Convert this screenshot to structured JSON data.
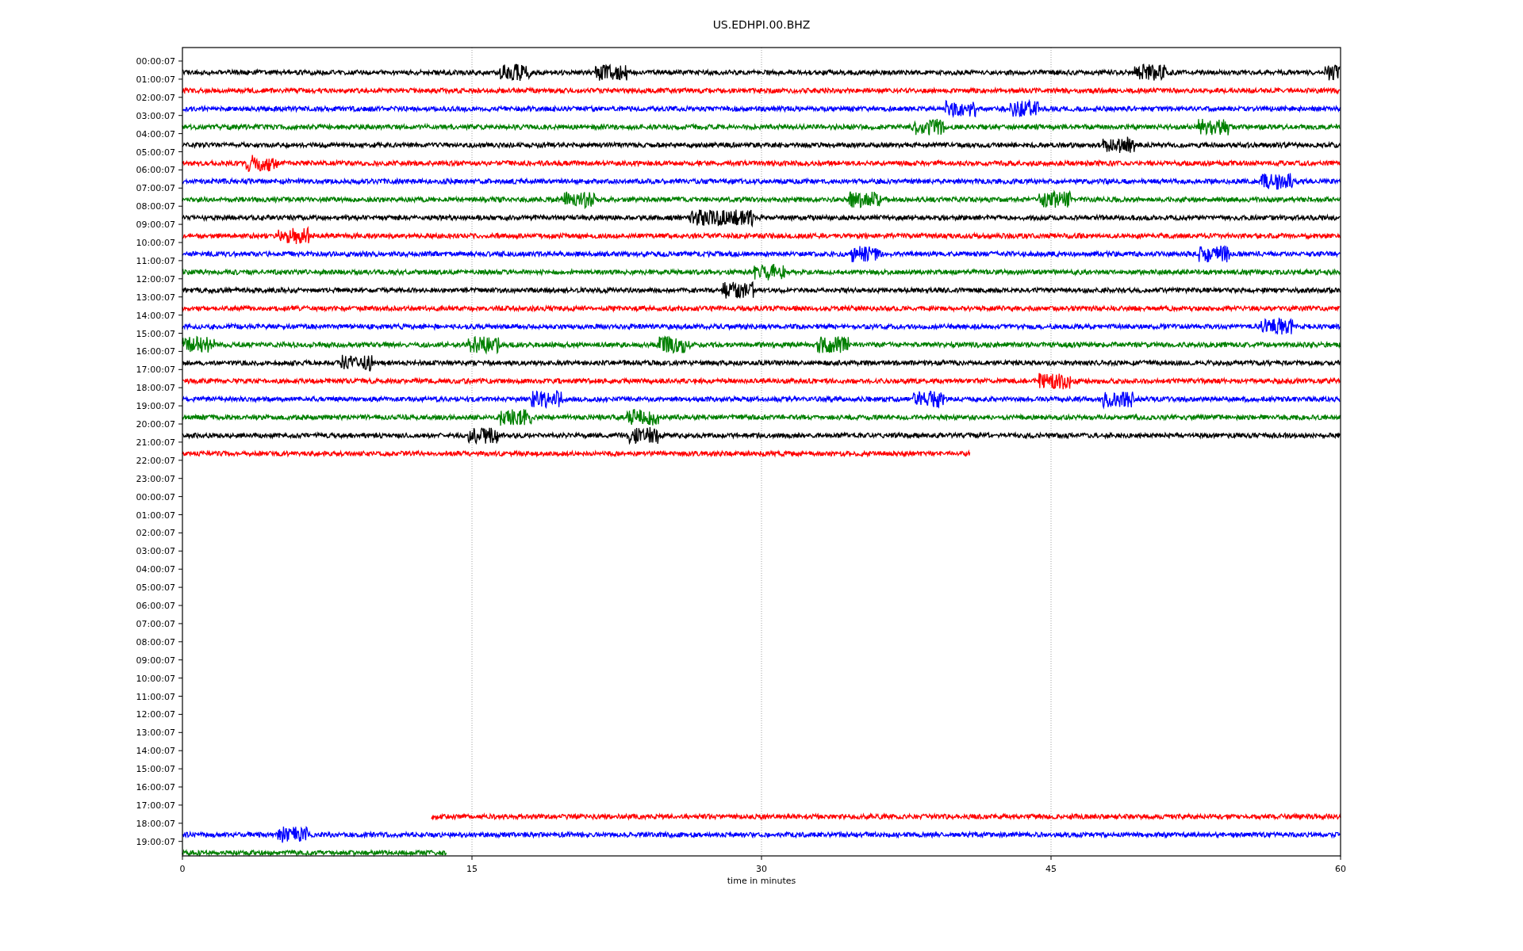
{
  "title": "US.EDHPI.00.BHZ",
  "xlabel": "time in minutes",
  "xticks": [
    "0",
    "15",
    "30",
    "45",
    "60"
  ],
  "rows": [
    {
      "label": "00:00:07",
      "trace": {
        "color": "#000000",
        "level": 1
      }
    },
    {
      "label": "01:00:07",
      "trace": {
        "color": "#ff0000",
        "level": 1
      }
    },
    {
      "label": "02:00:07",
      "trace": {
        "color": "#0000ff",
        "level": 1
      }
    },
    {
      "label": "03:00:07",
      "trace": {
        "color": "#008000",
        "level": 1
      }
    },
    {
      "label": "04:00:07",
      "trace": {
        "color": "#000000",
        "level": 1
      }
    },
    {
      "label": "05:00:07",
      "trace": {
        "color": "#ff0000",
        "level": 1
      }
    },
    {
      "label": "06:00:07",
      "trace": {
        "color": "#0000ff",
        "level": 1
      }
    },
    {
      "label": "07:00:07",
      "trace": {
        "color": "#008000",
        "level": 1
      }
    },
    {
      "label": "08:00:07",
      "trace": {
        "color": "#000000",
        "level": 1
      }
    },
    {
      "label": "09:00:07",
      "trace": {
        "color": "#ff0000",
        "level": 1
      }
    },
    {
      "label": "10:00:07",
      "trace": {
        "color": "#0000ff",
        "level": 1
      }
    },
    {
      "label": "11:00:07",
      "trace": {
        "color": "#008000",
        "level": 1
      }
    },
    {
      "label": "12:00:07",
      "trace": {
        "color": "#000000",
        "level": 1
      }
    },
    {
      "label": "13:00:07",
      "trace": {
        "color": "#ff0000",
        "level": 1
      }
    },
    {
      "label": "14:00:07",
      "trace": {
        "color": "#0000ff",
        "level": 1
      }
    },
    {
      "label": "15:00:07",
      "trace": {
        "color": "#008000",
        "level": 1
      }
    },
    {
      "label": "16:00:07",
      "trace": {
        "color": "#000000",
        "level": 1
      }
    },
    {
      "label": "17:00:07",
      "trace": {
        "color": "#ff0000",
        "level": 1
      }
    },
    {
      "label": "18:00:07",
      "trace": {
        "color": "#0000ff",
        "level": 1
      }
    },
    {
      "label": "19:00:07",
      "trace": {
        "color": "#008000",
        "level": 1
      }
    },
    {
      "label": "20:00:07",
      "trace": {
        "color": "#000000",
        "level": 1
      }
    },
    {
      "label": "21:00:07",
      "trace": {
        "color": "#ff0000",
        "level": 0.68,
        "starts_late": false
      }
    },
    {
      "label": "22:00:07"
    },
    {
      "label": "23:00:07"
    },
    {
      "label": "00:00:07"
    },
    {
      "label": "01:00:07"
    },
    {
      "label": "02:00:07"
    },
    {
      "label": "03:00:07"
    },
    {
      "label": "04:00:07"
    },
    {
      "label": "05:00:07"
    },
    {
      "label": "06:00:07"
    },
    {
      "label": "07:00:07"
    },
    {
      "label": "08:00:07"
    },
    {
      "label": "09:00:07"
    },
    {
      "label": "10:00:07"
    },
    {
      "label": "11:00:07"
    },
    {
      "label": "12:00:07"
    },
    {
      "label": "13:00:07"
    },
    {
      "label": "14:00:07"
    },
    {
      "label": "15:00:07"
    },
    {
      "label": "16:00:07"
    },
    {
      "label": "17:00:07",
      "trace": {
        "color": "#ff0000",
        "level": 0.785,
        "starts_late": true
      }
    },
    {
      "label": "18:00:07",
      "trace": {
        "color": "#0000ff",
        "level": 1
      }
    },
    {
      "label": "19:00:07",
      "trace": {
        "color": "#008000",
        "level": 0.228,
        "starts_late": false
      }
    }
  ]
}
